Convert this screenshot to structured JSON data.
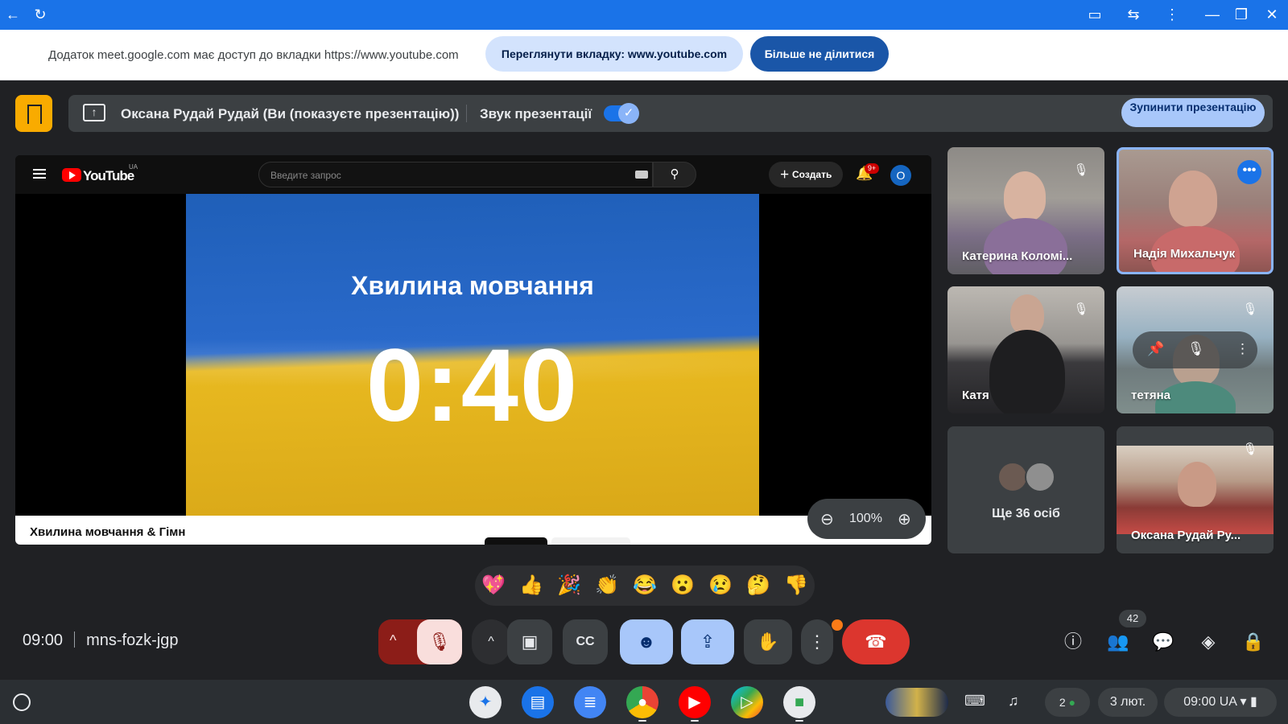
{
  "chrome": {
    "back_icon": "←",
    "reload_icon": "↻",
    "right_icons": [
      "▭",
      "⇆",
      "⋮",
      "—",
      "❐",
      "✕"
    ]
  },
  "infobar": {
    "message": "Додаток meet.google.com має доступ до вкладки https://www.youtube.com",
    "view_tab_button": "Переглянути вкладку: www.youtube.com",
    "stop_sharing_button": "Більше не ділитися"
  },
  "presentation_bar": {
    "presenter_text": "Оксана Рудай Рудай (Ви (показуєте презентацію))",
    "audio_label": "Звук презентації",
    "audio_enabled": true,
    "stop_button": "Зупинити презентацію"
  },
  "youtube": {
    "brand": "YouTube",
    "region": "UA",
    "search_placeholder": "Введите запрос",
    "create_button": "Создать",
    "notification_badge": "9+",
    "avatar_letter": "О",
    "video_overlay_title": "Хвилина мовчання",
    "video_overlay_timer": "0:40",
    "video_title": "Хвилина мовчання & Гімн"
  },
  "zoom": {
    "value": "100%"
  },
  "participants": [
    {
      "name": "Катерина Коломі...",
      "muted": true
    },
    {
      "name": "Надія Михальчук",
      "muted": false,
      "active": true
    },
    {
      "name": "Катя",
      "muted": true
    },
    {
      "name": "тетяна",
      "muted": true
    },
    {
      "name": "Ще 36 осіб"
    },
    {
      "name": "Оксана Рудай Ру...",
      "muted": true
    }
  ],
  "reactions": [
    "💖",
    "👍",
    "🎉",
    "👏",
    "😂",
    "😮",
    "😢",
    "🤔",
    "👎"
  ],
  "meeting": {
    "time": "09:00",
    "code": "mns-fozk-jgp",
    "people_count": "42"
  },
  "controls": {
    "caret": "^",
    "mic_icon": "🎙",
    "camera_icon": "▣",
    "captions_icon": "CC",
    "emoji_icon": "☻",
    "present_icon": "⇪",
    "hand_icon": "✋",
    "more_icon": "⋮",
    "hangup_icon": "☎",
    "info_icon": "ⓘ",
    "people_icon": "👥",
    "chat_icon": "💬",
    "activities_icon": "◈",
    "host_controls_icon": "🔒"
  },
  "shelf": {
    "date": "3 лют.",
    "time_status": "09:00 UA",
    "notifications_count": "2"
  },
  "colors": {
    "chrome_blue": "#1a73e8",
    "meet_bg": "#202124",
    "accent_blue": "#a8c7fa",
    "hangup_red": "#dc362e"
  }
}
